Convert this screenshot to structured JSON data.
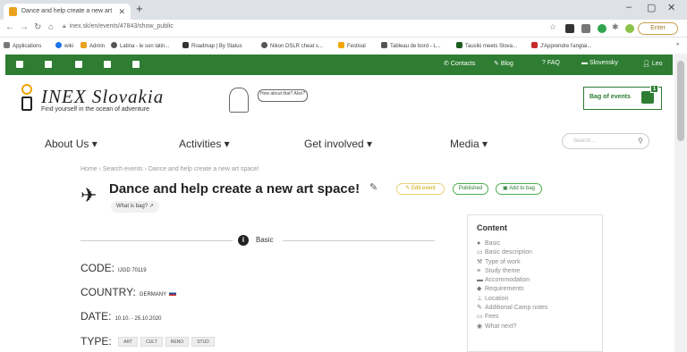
{
  "browser": {
    "tab_title": "Dance and help create a new art",
    "new_tab": "+",
    "url": "inex.sk/en/events/47843/show_public",
    "enter_label": "Enter",
    "bookmarks": [
      "Applications",
      "wiki",
      "Admin",
      "Latina - le son latin...",
      "Roadmap | By Status",
      "Nikon DSLR cheat s...",
      "Festival",
      "Tableau de bord - L...",
      "Tausiki meets Slova...",
      "J'Apprendre l'anglai..."
    ]
  },
  "topbar": {
    "contacts": "Contacts",
    "blog": "Blog",
    "faq": "FAQ",
    "language": "Slovensky",
    "user": "Leo"
  },
  "header": {
    "logo_name": "INEX Slovakia",
    "logo_tagline": "Find yourself in the ocean of adventure",
    "speech_bubble": "How about that? Also?",
    "bag_label": "Bag of events",
    "bag_count": "1"
  },
  "nav": {
    "items": [
      "About Us ▾",
      "Activities ▾",
      "Get involved ▾",
      "Media ▾"
    ],
    "search_placeholder": "Search..."
  },
  "event": {
    "breadcrumb": "Home › Search events › Dance and help create a new art space!",
    "title": "Dance and help create a new art space!",
    "edit_label": "Edit event",
    "published_label": "Published",
    "add_label": "Add to bag",
    "what_is_bag": "What is bag?",
    "section_title": "Basic",
    "code_label": "CODE:",
    "code_value": "IJGD 70119",
    "country_label": "COUNTRY:",
    "country_value": "GERMANY",
    "date_label": "DATE:",
    "date_value": "10.10. - 25.10.2020",
    "type_label": "TYPE:",
    "types": [
      "ART",
      "CULT",
      "RENO",
      "STUD"
    ]
  },
  "content_box": {
    "heading": "Content",
    "items": [
      "Basic",
      "Basic description",
      "Type of work",
      "Study theme",
      "Accommodation",
      "Requirements",
      "Location",
      "Additional Camp notes",
      "Fees",
      "What next?"
    ]
  },
  "colors": {
    "brand_green": "#2e7d32",
    "accent_yellow": "#f0a500"
  }
}
